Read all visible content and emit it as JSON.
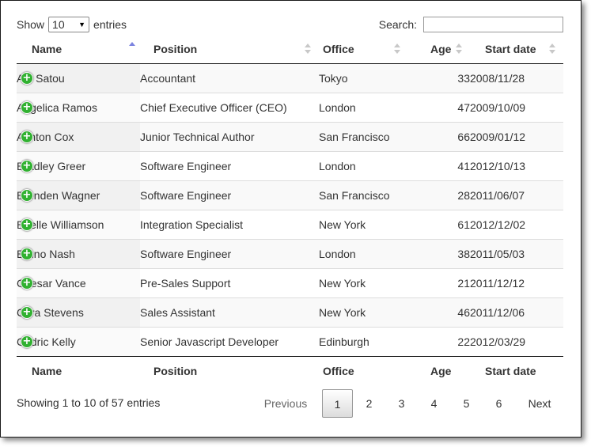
{
  "controls": {
    "show_label": "Show",
    "length_value": "10",
    "entries_label": "entries",
    "search_label": "Search:",
    "search_value": ""
  },
  "columns": {
    "name": "Name",
    "position": "Position",
    "office": "Office",
    "age": "Age",
    "start_date": "Start date"
  },
  "rows": [
    {
      "name": "Airi Satou",
      "position": "Accountant",
      "office": "Tokyo",
      "age": "33",
      "start_date": "2008/11/28"
    },
    {
      "name": "Angelica Ramos",
      "position": "Chief Executive Officer (CEO)",
      "office": "London",
      "age": "47",
      "start_date": "2009/10/09"
    },
    {
      "name": "Ashton Cox",
      "position": "Junior Technical Author",
      "office": "San Francisco",
      "age": "66",
      "start_date": "2009/01/12"
    },
    {
      "name": "Bradley Greer",
      "position": "Software Engineer",
      "office": "London",
      "age": "41",
      "start_date": "2012/10/13"
    },
    {
      "name": "Brenden Wagner",
      "position": "Software Engineer",
      "office": "San Francisco",
      "age": "28",
      "start_date": "2011/06/07"
    },
    {
      "name": "Brielle Williamson",
      "position": "Integration Specialist",
      "office": "New York",
      "age": "61",
      "start_date": "2012/12/02"
    },
    {
      "name": "Bruno Nash",
      "position": "Software Engineer",
      "office": "London",
      "age": "38",
      "start_date": "2011/05/03"
    },
    {
      "name": "Caesar Vance",
      "position": "Pre-Sales Support",
      "office": "New York",
      "age": "21",
      "start_date": "2011/12/12"
    },
    {
      "name": "Cara Stevens",
      "position": "Sales Assistant",
      "office": "New York",
      "age": "46",
      "start_date": "2011/12/06"
    },
    {
      "name": "Cedric Kelly",
      "position": "Senior Javascript Developer",
      "office": "Edinburgh",
      "age": "22",
      "start_date": "2012/03/29"
    }
  ],
  "expand_icon": "plus-circle-icon",
  "colors": {
    "expand": "#31b131",
    "sort_active": "#7b83e0",
    "sort_inactive": "#c8c8c8"
  },
  "info": "Showing 1 to 10 of 57 entries",
  "pagination": {
    "previous": "Previous",
    "pages": [
      "1",
      "2",
      "3",
      "4",
      "5",
      "6"
    ],
    "current": "1",
    "next": "Next"
  }
}
